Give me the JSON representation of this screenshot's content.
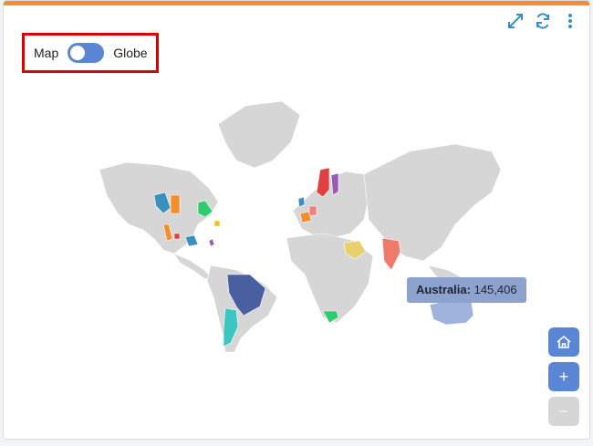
{
  "toggle": {
    "left_label": "Map",
    "right_label": "Globe"
  },
  "tooltip": {
    "country": "Australia:",
    "value": "145,406"
  },
  "zoom": {
    "plus": "+",
    "minus": "−"
  },
  "colors": {
    "accent_bar": "#f28e2b",
    "land": "#d6d6d6",
    "hover_region": "#9fb3dd",
    "toggle": "#5b86d6"
  },
  "icons": {
    "expand": "expand-icon",
    "refresh": "refresh-icon",
    "menu": "more-vertical-icon",
    "home": "home-icon"
  }
}
